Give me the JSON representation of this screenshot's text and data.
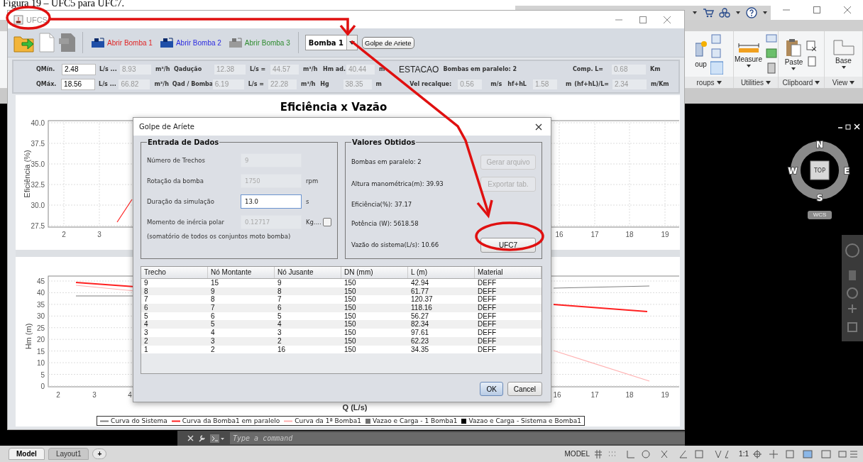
{
  "caption": "Figura 19 – UFC5 para UFC7.",
  "cad": {
    "ribbon_sections": [
      {
        "kind": "group",
        "tool": "oup",
        "label": "roups"
      },
      {
        "kind": "measure",
        "tool": "Measure",
        "label": "Utilities"
      },
      {
        "kind": "paste",
        "tool": "Paste",
        "label": "Clipboard"
      },
      {
        "kind": "base",
        "tool": "Base",
        "label": "View"
      }
    ],
    "viewcube": {
      "north": "N",
      "west": "W",
      "face": "TOP",
      "east": "E",
      "south": "S",
      "ucs": "WCS"
    },
    "command": {
      "placeholder": "Type a command"
    },
    "layout_tabs": [
      {
        "label": "Model",
        "selected": true
      },
      {
        "label": "Layout1",
        "selected": false
      }
    ],
    "add_tab": "+",
    "status": {
      "mode": "MODEL",
      "scale": "1:1"
    }
  },
  "ufcs": {
    "title": "UFCS",
    "pump_buttons": [
      {
        "label": "Abrir Bomba 1",
        "color": "#e02424",
        "disabled": false
      },
      {
        "label": "Abrir Bomba 2",
        "color": "#2a2ae0",
        "disabled": false
      },
      {
        "label": "Abrir Bomba 3",
        "color": "#2e8b2e",
        "disabled": true
      }
    ],
    "pump_select": "Bomba 1",
    "action_button": "Golpe de Ariete",
    "params": [
      [
        {
          "kind": "label",
          "text": "QMín."
        },
        {
          "kind": "field",
          "text": "2.48",
          "disabled": false
        },
        {
          "kind": "unit",
          "text": "L/s ..."
        },
        {
          "kind": "field",
          "text": "8.93",
          "disabled": true
        },
        {
          "kind": "unit",
          "text": "m³/h"
        },
        {
          "kind": "label",
          "text": "Qadução"
        },
        {
          "kind": "field",
          "text": "12.38",
          "disabled": true
        },
        {
          "kind": "unit",
          "text": "L/s ="
        },
        {
          "kind": "field",
          "text": "44.57",
          "disabled": true
        },
        {
          "kind": "unit",
          "text": "m³/h"
        },
        {
          "kind": "label",
          "text": "Hm ad."
        },
        {
          "kind": "field",
          "text": "40.44",
          "disabled": true
        },
        {
          "kind": "unit",
          "text": "m"
        },
        {
          "kind": "heading",
          "text": "ESTACAO"
        },
        {
          "kind": "label",
          "text": "Bombas em paralelo: 2"
        },
        {
          "kind": "label",
          "text": "Comp. L="
        },
        {
          "kind": "field",
          "text": "0.68",
          "disabled": true
        },
        {
          "kind": "unit",
          "text": "Km"
        }
      ],
      [
        {
          "kind": "label",
          "text": "QMáx."
        },
        {
          "kind": "field",
          "text": "18.56",
          "disabled": false
        },
        {
          "kind": "unit",
          "text": "L/s ..."
        },
        {
          "kind": "field",
          "text": "66.82",
          "disabled": true
        },
        {
          "kind": "unit",
          "text": "m³/h"
        },
        {
          "kind": "label",
          "text": "Qad / Bomba"
        },
        {
          "kind": "field",
          "text": "6.19",
          "disabled": true
        },
        {
          "kind": "unit",
          "text": "L/s ="
        },
        {
          "kind": "field",
          "text": "22.28",
          "disabled": true
        },
        {
          "kind": "unit",
          "text": "m³/h"
        },
        {
          "kind": "label",
          "text": "Hg"
        },
        {
          "kind": "field",
          "text": "38.35",
          "disabled": true
        },
        {
          "kind": "unit",
          "text": "m"
        },
        {
          "kind": "label",
          "text": "Vel recalque:"
        },
        {
          "kind": "field",
          "text": "0.56",
          "disabled": true
        },
        {
          "kind": "unit",
          "text": "m/s"
        },
        {
          "kind": "label",
          "text": "hf+hL"
        },
        {
          "kind": "field",
          "text": "1.58",
          "disabled": true
        },
        {
          "kind": "unit",
          "text": "m"
        },
        {
          "kind": "label",
          "text": "(hf+hL)/L="
        },
        {
          "kind": "field",
          "text": "2.34",
          "disabled": true
        },
        {
          "kind": "unit",
          "text": "m/Km"
        }
      ]
    ],
    "chart_top": {
      "title": "Eficiência x Vazão",
      "ylabel": "Eficiência (%)",
      "yticks": [
        "40.0",
        "37.5",
        "35.0",
        "32.5",
        "30.0",
        "27.5"
      ],
      "xticks": [
        "2",
        "3",
        "16",
        "17",
        "18",
        "19"
      ]
    },
    "chart_bottom": {
      "ylabel": "Hm (m)",
      "xlabel": "Q (L/s)",
      "yticks": [
        "45",
        "40",
        "35",
        "30",
        "25",
        "20",
        "15",
        "10",
        "5",
        "0"
      ],
      "xticks": [
        "2",
        "3",
        "4",
        "16",
        "17",
        "18",
        "19"
      ],
      "legend": [
        {
          "label": "Curva do Sistema",
          "kind": "line",
          "color": "#808080"
        },
        {
          "label": "Curva da Bomba1 em paralelo",
          "kind": "line",
          "color": "#ff2020"
        },
        {
          "label": "Curva da 1ª Bomba1",
          "kind": "line",
          "color": "#ffb0b0"
        },
        {
          "label": "Vazao e Carga - 1 Bomba1",
          "kind": "square",
          "color": "#707070"
        },
        {
          "label": "Vazao e Carga - Sistema e Bomba1",
          "kind": "square",
          "color": "#000000"
        }
      ]
    }
  },
  "dialog": {
    "title": "Golpe de Aríete",
    "input_panel": {
      "title": "Entrada de Dados",
      "rows": [
        {
          "label": "Número de Trechos",
          "value": "9",
          "disabled": true
        },
        {
          "label": "Rotação da bomba",
          "value": "1750",
          "unit": "rpm",
          "disabled": true
        },
        {
          "label": "Duração da simulação",
          "value": "13.0",
          "unit": "s",
          "disabled": false
        },
        {
          "label": "Momento de inércia polar",
          "value": "0.12717",
          "unit": "Kg....",
          "disabled": true,
          "checkbox": {
            "checked": false
          }
        }
      ],
      "note": "(somatório de todos os conjuntos moto bomba)"
    },
    "results_panel": {
      "title": "Valores Obtidos",
      "lines": [
        "Bombas em paralelo: 2",
        "Altura manométrica(m): 39.93",
        "Eficiência(%): 37.17",
        "Potência (W): 5618.58",
        "Vazão do sistema(L/s): 10.66"
      ],
      "buttons": [
        {
          "label": "Gerar arquivo",
          "disabled": true
        },
        {
          "label": "Exportar tab.",
          "disabled": true
        },
        {
          "label": "UFC7",
          "disabled": false
        }
      ]
    },
    "table": {
      "columns": [
        "Trecho",
        "Nó Montante",
        "Nó Jusante",
        "DN (mm)",
        "L (m)",
        "Material"
      ],
      "rows": [
        [
          "9",
          "15",
          "9",
          "150",
          "42.94",
          "DEFF"
        ],
        [
          "8",
          "9",
          "8",
          "150",
          "61.77",
          "DEFF"
        ],
        [
          "7",
          "8",
          "7",
          "150",
          "120.37",
          "DEFF"
        ],
        [
          "6",
          "7",
          "6",
          "150",
          "118.16",
          "DEFF"
        ],
        [
          "5",
          "6",
          "5",
          "150",
          "56.27",
          "DEFF"
        ],
        [
          "4",
          "5",
          "4",
          "150",
          "82.34",
          "DEFF"
        ],
        [
          "3",
          "4",
          "3",
          "150",
          "97.61",
          "DEFF"
        ],
        [
          "2",
          "3",
          "2",
          "150",
          "62.23",
          "DEFF"
        ],
        [
          "1",
          "2",
          "16",
          "150",
          "34.35",
          "DEFF"
        ]
      ]
    },
    "buttons": [
      {
        "label": "OK",
        "default": true
      },
      {
        "label": "Cancel",
        "default": false
      }
    ]
  }
}
